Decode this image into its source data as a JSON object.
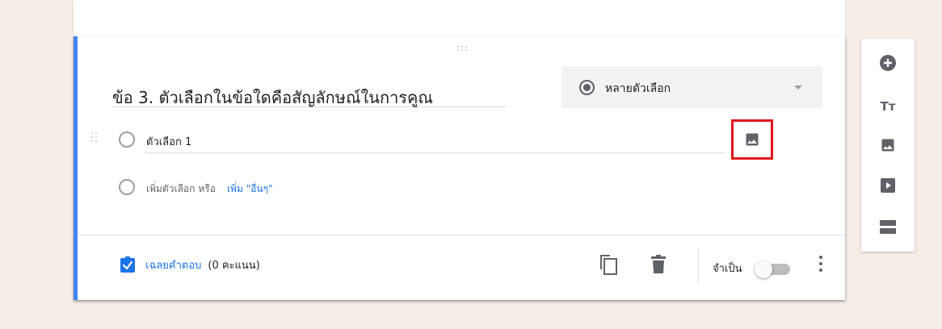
{
  "question": {
    "title": "ข้อ 3. ตัวเลือกในข้อใดคือสัญลักษณ์ในการคูณ",
    "type_label": "หลายตัวเลือก",
    "option1": "ตัวเลือก 1",
    "add_option": "เพิ่มตัวเลือก",
    "or": "หรือ",
    "add_other": "เพิ่ม \"อื่นๆ\""
  },
  "footer": {
    "answer_key": "เฉลยคำตอบ",
    "points": "(0 คะแนน)",
    "required": "จำเป็น",
    "required_on": false
  },
  "toolbar": {
    "items": [
      "add-question-icon",
      "title-text-icon",
      "image-icon",
      "video-icon",
      "section-icon"
    ],
    "text_glyph": "Tт"
  },
  "colors": {
    "accent": "#4285f4",
    "link": "#1a73e8",
    "highlight_box": "#e0161e",
    "background": "#f6ede8"
  }
}
